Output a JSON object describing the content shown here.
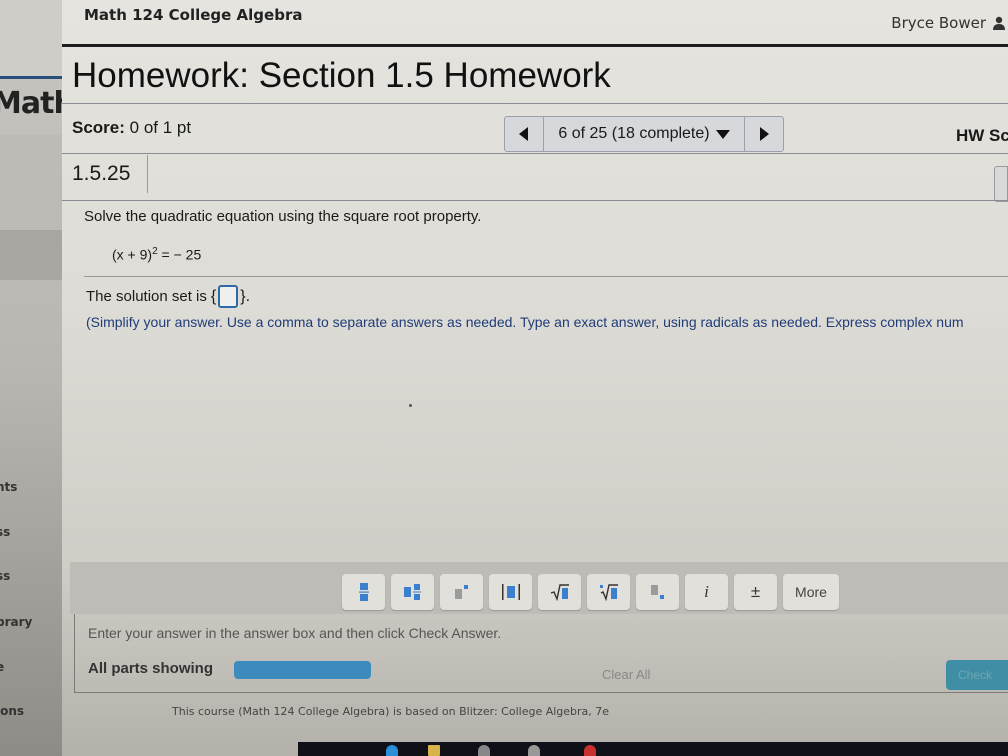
{
  "header": {
    "course": "Math 124 College Algebra",
    "user": "Bryce Bower",
    "title": "Homework: Section 1.5 Homework"
  },
  "sidebar": {
    "brand": "Math",
    "items": [
      "nts",
      "ss",
      "ss",
      "brary",
      "e",
      "ions"
    ]
  },
  "score": {
    "label": "Score:",
    "value": "0 of 1 pt"
  },
  "nav": {
    "position": "6 of 25 (18 complete)",
    "current": 6,
    "total": 25,
    "complete": 18
  },
  "hw_score_label": "HW Sc",
  "question": {
    "number": "1.5.25",
    "prompt": "Solve the quadratic equation using the square root property.",
    "equation_base": "(x + 9)",
    "equation_exp": "2",
    "equation_rhs": " = − 25",
    "solution_prefix": "The solution set is",
    "brace_open": "{",
    "brace_close": "}.",
    "hint": "(Simplify your answer. Use a comma to separate answers as needed. Type an exact answer, using radicals as needed. Express complex num"
  },
  "toolbar": {
    "buttons": [
      {
        "name": "fraction",
        "icon": "fraction-icon"
      },
      {
        "name": "mixed-number",
        "icon": "mixed-number-icon"
      },
      {
        "name": "exponent",
        "icon": "exponent-icon"
      },
      {
        "name": "absolute-value",
        "icon": "absolute-value-icon"
      },
      {
        "name": "square-root",
        "icon": "square-root-icon"
      },
      {
        "name": "nth-root",
        "icon": "nth-root-icon"
      },
      {
        "name": "subscript",
        "icon": "subscript-icon"
      },
      {
        "name": "imaginary-i",
        "icon": "imaginary-i-icon",
        "label": "i"
      },
      {
        "name": "plus-minus",
        "icon": "plus-minus-icon",
        "label": "±"
      }
    ],
    "more_label": "More"
  },
  "answer": {
    "message": "Enter your answer in the answer box and then click Check Answer.",
    "all_parts_label": "All parts showing",
    "progress_fraction": 1.0,
    "clear_all": "Clear All",
    "check_answer": "Check"
  },
  "footer": "This course (Math 124 College Algebra) is based on Blitzer: College Algebra, 7e",
  "colors": {
    "accent": "#3b7fcf",
    "hint_text": "#1f3c78",
    "progress": "#3d8bbd",
    "check_button": "#3f8ea5"
  }
}
